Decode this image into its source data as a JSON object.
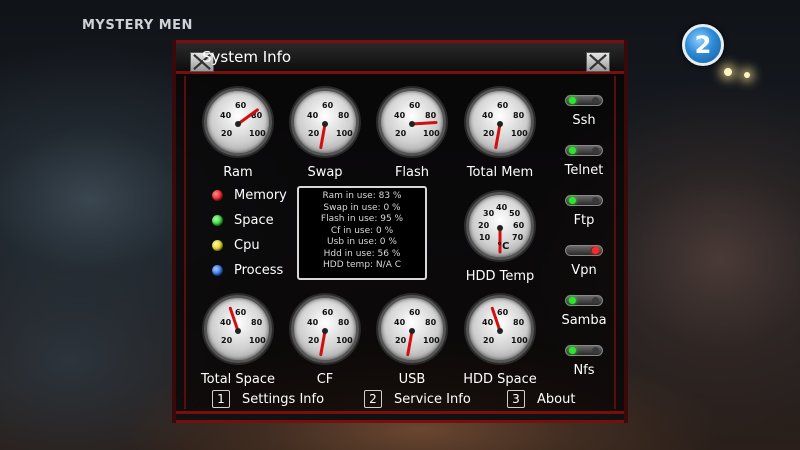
{
  "channel": {
    "name": "MYSTERY MEN",
    "number": "2"
  },
  "window": {
    "title": "System Info"
  },
  "colors": {
    "frame_red": "#7a0d0d",
    "needle_red": "#d10f0f",
    "on_green": "#2ee52e",
    "off_red": "#ff2a2a"
  },
  "gauges_top": [
    {
      "label": "Ram",
      "scale": [
        "20",
        "40",
        "60",
        "80",
        "100"
      ],
      "value_pct": 83
    },
    {
      "label": "Swap",
      "scale": [
        "20",
        "40",
        "60",
        "80",
        "100"
      ],
      "value_pct": 0
    },
    {
      "label": "Flash",
      "scale": [
        "20",
        "40",
        "60",
        "80",
        "100"
      ],
      "value_pct": 95
    },
    {
      "label": "Total Mem",
      "scale": [
        "20",
        "40",
        "60",
        "80",
        "100"
      ],
      "value_pct": 0
    }
  ],
  "gauges_bottom": [
    {
      "label": "Total Space",
      "scale": [
        "20",
        "40",
        "60",
        "80",
        "100"
      ],
      "value_pct": 56
    },
    {
      "label": "CF",
      "scale": [
        "20",
        "40",
        "60",
        "80",
        "100"
      ],
      "value_pct": 0
    },
    {
      "label": "USB",
      "scale": [
        "20",
        "40",
        "60",
        "80",
        "100"
      ],
      "value_pct": 0
    },
    {
      "label": "HDD Space",
      "scale": [
        "20",
        "40",
        "60",
        "80",
        "100"
      ],
      "value_pct": 56
    }
  ],
  "hdd_temp_gauge": {
    "label": "HDD Temp",
    "unit": "°C",
    "scale": [
      "10",
      "20",
      "30",
      "40",
      "50",
      "60",
      "70"
    ],
    "value": 0
  },
  "legend": [
    {
      "label": "Memory",
      "color": "#e02020"
    },
    {
      "label": "Space",
      "color": "#2ed02e"
    },
    {
      "label": "Cpu",
      "color": "#e0d020"
    },
    {
      "label": "Process",
      "color": "#2a6ae0"
    }
  ],
  "info_lines": [
    "Ram in use: 83 %",
    "Swap in use: 0 %",
    "Flash in use: 95 %",
    "Cf in use: 0 %",
    "Usb in use: 0 %",
    "Hdd in use: 56 %",
    "HDD temp: N/A C"
  ],
  "services": [
    {
      "label": "Ssh",
      "state": "on"
    },
    {
      "label": "Telnet",
      "state": "on"
    },
    {
      "label": "Ftp",
      "state": "on"
    },
    {
      "label": "Vpn",
      "state": "off"
    },
    {
      "label": "Samba",
      "state": "on"
    },
    {
      "label": "Nfs",
      "state": "on"
    }
  ],
  "nav": [
    {
      "key": "1",
      "label": "Settings Info"
    },
    {
      "key": "2",
      "label": "Service Info"
    },
    {
      "key": "3",
      "label": "About"
    }
  ]
}
